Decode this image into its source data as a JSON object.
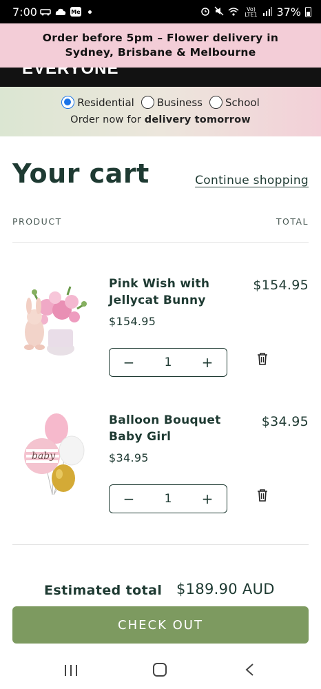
{
  "status_bar": {
    "time": "7:00",
    "left_icons": [
      "notification-icon",
      "cloud-icon",
      "me-icon"
    ],
    "me_icon_text": "Me",
    "network_text": "Vo) LTE1",
    "battery": "37%"
  },
  "announcement": {
    "text": "Order before 5pm – Flower delivery in Sydney, Brisbane & Melbourne"
  },
  "header": {
    "logo_text": "EVERYONE"
  },
  "customer_type": {
    "options": [
      {
        "label": "Residential",
        "checked": true
      },
      {
        "label": "Business",
        "checked": false
      },
      {
        "label": "School",
        "checked": false
      }
    ],
    "note_prefix": "Order now for ",
    "note_bold": "delivery tomorrow"
  },
  "cart": {
    "title": "Your cart",
    "continue_label": "Continue shopping",
    "col_product": "PRODUCT",
    "col_total": "TOTAL",
    "items": [
      {
        "name": "Pink Wish with Jellycat Bunny",
        "unit_price": "$154.95",
        "total": "$154.95",
        "quantity": "1",
        "image": "pink-flowers-bunny"
      },
      {
        "name": "Balloon Bouquet Baby Girl",
        "unit_price": "$34.95",
        "total": "$34.95",
        "quantity": "1",
        "image": "balloon-bouquet"
      }
    ],
    "qty_minus": "−",
    "qty_plus": "+",
    "estimated_label": "Estimated total",
    "estimated_value": "$189.90 AUD",
    "checkout_label": "CHECK OUT"
  },
  "colors": {
    "primary_text": "#1e3a32",
    "checkout_bg": "#7d9a60",
    "announcement_bg": "#f3cdd7",
    "radio_accent": "#1a73e8"
  }
}
